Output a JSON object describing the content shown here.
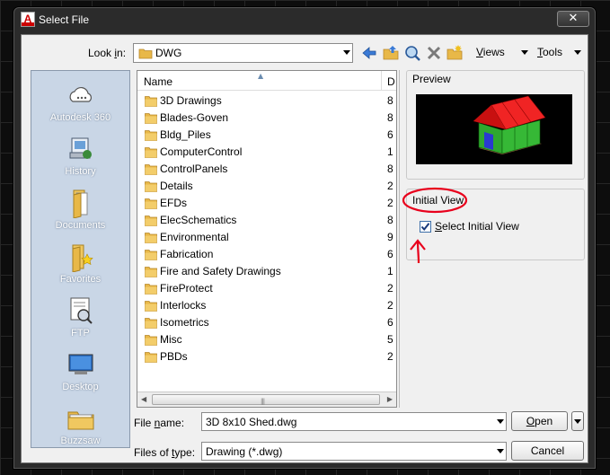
{
  "window": {
    "title": "Select File",
    "close_glyph": "✕"
  },
  "lookin": {
    "label_pre": "Look ",
    "label_u": "i",
    "label_post": "n:",
    "value": "DWG"
  },
  "toolbar": {
    "views_u": "V",
    "views_rest": "iews",
    "tools_u": "T",
    "tools_rest": "ools",
    "icons": [
      "back-arrow-icon",
      "up-folder-icon",
      "search-web-icon",
      "delete-icon",
      "new-folder-icon"
    ]
  },
  "places": [
    {
      "label": "Autodesk 360",
      "icon": "cloud-icon"
    },
    {
      "label": "History",
      "icon": "history-icon"
    },
    {
      "label": "Documents",
      "icon": "documents-folder-icon"
    },
    {
      "label": "Favorites",
      "icon": "favorites-folder-icon"
    },
    {
      "label": "FTP",
      "icon": "ftp-icon"
    },
    {
      "label": "Desktop",
      "icon": "desktop-icon"
    },
    {
      "label": "Buzzsaw",
      "icon": "buzzsaw-icon"
    }
  ],
  "filelist": {
    "col_name": "Name",
    "col_date": "D",
    "rows": [
      {
        "name": "3D Drawings",
        "date": "8"
      },
      {
        "name": "Blades-Goven",
        "date": "8"
      },
      {
        "name": "Bldg_Piles",
        "date": "6"
      },
      {
        "name": "ComputerControl",
        "date": "1"
      },
      {
        "name": "ControlPanels",
        "date": "8"
      },
      {
        "name": "Details",
        "date": "2"
      },
      {
        "name": "EFDs",
        "date": "2"
      },
      {
        "name": "ElecSchematics",
        "date": "8"
      },
      {
        "name": "Environmental",
        "date": "9"
      },
      {
        "name": "Fabrication",
        "date": "6"
      },
      {
        "name": "Fire and Safety Drawings",
        "date": "1"
      },
      {
        "name": "FireProtect",
        "date": "2"
      },
      {
        "name": "Interlocks",
        "date": "2"
      },
      {
        "name": "Isometrics",
        "date": "6"
      },
      {
        "name": "Misc",
        "date": "5"
      },
      {
        "name": "PBDs",
        "date": "2"
      }
    ]
  },
  "preview": {
    "caption": "Preview"
  },
  "initial_view": {
    "caption": "Initial View",
    "checkbox_u": "S",
    "checkbox_rest": "elect Initial View",
    "checked": true
  },
  "filename": {
    "label_pre": "File ",
    "label_u": "n",
    "label_post": "ame:",
    "value": "3D 8x10 Shed.dwg"
  },
  "filetype": {
    "label_pre": "Files of ",
    "label_u": "t",
    "label_post": "ype:",
    "value": "Drawing (*.dwg)"
  },
  "buttons": {
    "open_u": "O",
    "open_rest": "pen",
    "cancel": "Cancel"
  },
  "colors": {
    "annotation": "#e8001c",
    "places_bg": "#c9d6e6",
    "folder": "#e8b848"
  }
}
